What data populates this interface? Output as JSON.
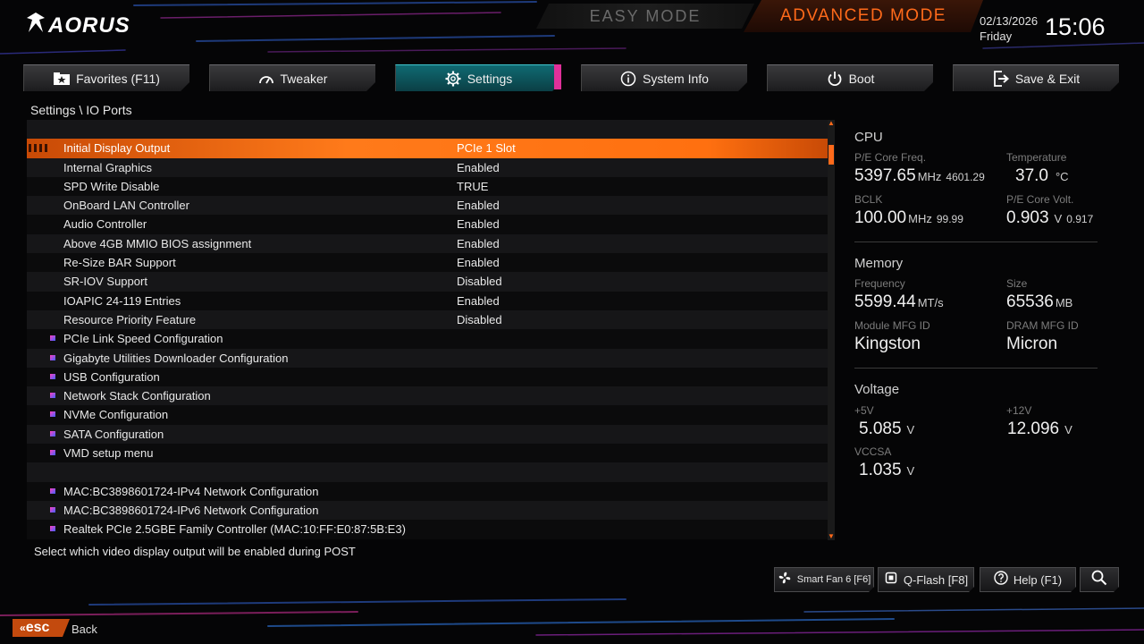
{
  "header": {
    "brand": "AORUS",
    "easy_mode_label": "EASY MODE",
    "advanced_mode_label": "ADVANCED MODE",
    "date": "02/13/2026",
    "weekday": "Friday",
    "time": "15:06"
  },
  "tabs": [
    {
      "label": "Favorites (F11)",
      "icon": "star-folder-icon"
    },
    {
      "label": "Tweaker",
      "icon": "gauge-icon"
    },
    {
      "label": "Settings",
      "icon": "gear-icon"
    },
    {
      "label": "System Info",
      "icon": "info-icon"
    },
    {
      "label": "Boot",
      "icon": "power-icon"
    },
    {
      "label": "Save & Exit",
      "icon": "exit-icon"
    }
  ],
  "breadcrumb": "Settings \\ IO Ports",
  "rows": [
    {
      "label": "",
      "value": ""
    },
    {
      "label": "Initial Display Output",
      "value": "PCIe 1 Slot"
    },
    {
      "label": "Internal Graphics",
      "value": "Enabled"
    },
    {
      "label": "SPD Write Disable",
      "value": "TRUE"
    },
    {
      "label": "OnBoard LAN Controller",
      "value": "Enabled"
    },
    {
      "label": "Audio Controller",
      "value": "Enabled"
    },
    {
      "label": "Above 4GB MMIO BIOS assignment",
      "value": "Enabled"
    },
    {
      "label": "Re-Size BAR Support",
      "value": "Enabled"
    },
    {
      "label": "SR-IOV Support",
      "value": "Disabled"
    },
    {
      "label": "IOAPIC 24-119 Entries",
      "value": "Enabled"
    },
    {
      "label": "Resource Priority Feature",
      "value": "Disabled"
    },
    {
      "label": "PCIe Link Speed Configuration",
      "value": ""
    },
    {
      "label": "Gigabyte Utilities Downloader Configuration",
      "value": ""
    },
    {
      "label": "USB Configuration",
      "value": ""
    },
    {
      "label": "Network Stack Configuration",
      "value": ""
    },
    {
      "label": "NVMe Configuration",
      "value": ""
    },
    {
      "label": "SATA Configuration",
      "value": ""
    },
    {
      "label": "VMD setup menu",
      "value": ""
    },
    {
      "label": "",
      "value": ""
    },
    {
      "label": "MAC:BC3898601724-IPv4 Network Configuration",
      "value": ""
    },
    {
      "label": "MAC:BC3898601724-IPv6 Network Configuration",
      "value": ""
    },
    {
      "label": "Realtek PCIe 2.5GBE Family Controller (MAC:10:FF:E0:87:5B:E3)",
      "value": ""
    }
  ],
  "help_text": "Select which video display output will be enabled during POST",
  "cpu": {
    "title": "CPU",
    "freq_label": "P/E Core Freq.",
    "freq_value": "5397.65",
    "freq_unit": "MHz",
    "freq_sub": "4601.29",
    "temp_label": "Temperature",
    "temp_value": "37.0",
    "temp_unit": "°C",
    "bclk_label": "BCLK",
    "bclk_value": "100.00",
    "bclk_unit": "MHz",
    "bclk_sub": "99.99",
    "volt_label": "P/E Core Volt.",
    "volt_value": "0.903",
    "volt_unit": "V",
    "volt_sub": "0.917"
  },
  "memory": {
    "title": "Memory",
    "freq_label": "Frequency",
    "freq_value": "5599.44",
    "freq_unit": "MT/s",
    "size_label": "Size",
    "size_value": "65536",
    "size_unit": "MB",
    "module_label": "Module MFG ID",
    "module_value": "Kingston",
    "dram_label": "DRAM MFG ID",
    "dram_value": "Micron"
  },
  "voltage": {
    "title": "Voltage",
    "v5_label": "+5V",
    "v5_value": "5.085",
    "v5_unit": "V",
    "v12_label": "+12V",
    "v12_value": "12.096",
    "v12_unit": "V",
    "vccsa_label": "VCCSA",
    "vccsa_value": "1.035",
    "vccsa_unit": "V"
  },
  "bottom": {
    "smart_fan": "Smart Fan 6 [F6]",
    "qflash": "Q-Flash [F8]",
    "help": "Help (F1)",
    "esc_label": "esc",
    "back_label": "Back"
  },
  "colors": {
    "accent_orange": "#ff6a1a",
    "settings_tab": "#0f6a72",
    "tab_accent": "#e0309a"
  }
}
